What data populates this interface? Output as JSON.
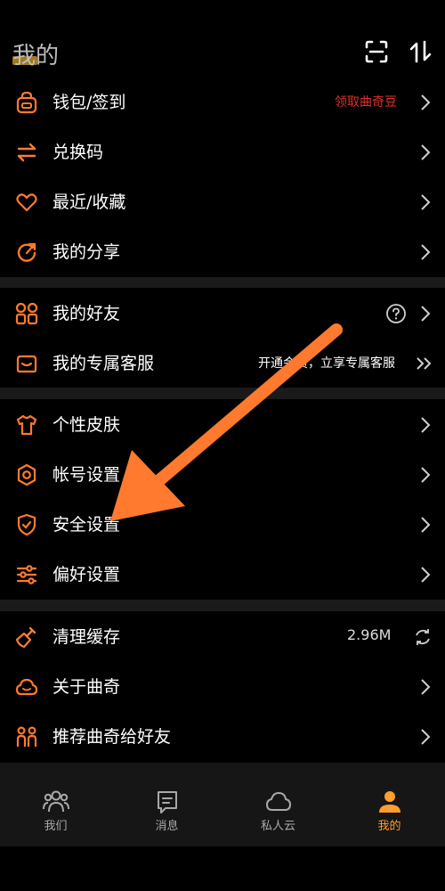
{
  "header": {
    "title": "我的"
  },
  "group1": [
    {
      "key": "wallet",
      "label": "钱包/签到",
      "extra": "领取曲奇豆",
      "icon": "wallet-icon"
    },
    {
      "key": "redeem",
      "label": "兑换码",
      "icon": "exchange-icon"
    },
    {
      "key": "recent",
      "label": "最近/收藏",
      "icon": "heart-icon"
    },
    {
      "key": "share",
      "label": "我的分享",
      "icon": "share-icon"
    }
  ],
  "group2": [
    {
      "key": "friends",
      "label": "我的好友",
      "icon": "friends-icon"
    },
    {
      "key": "service",
      "label": "我的专属客服",
      "extra": "开通会员，立享专属客服",
      "icon": "customer-service-icon"
    }
  ],
  "group3": [
    {
      "key": "skin",
      "label": "个性皮肤",
      "icon": "shirt-icon"
    },
    {
      "key": "account",
      "label": "帐号设置",
      "icon": "gear-icon"
    },
    {
      "key": "security",
      "label": "安全设置",
      "icon": "shield-icon"
    },
    {
      "key": "prefs",
      "label": "偏好设置",
      "icon": "sliders-icon"
    }
  ],
  "group4": [
    {
      "key": "cache",
      "label": "清理缓存",
      "extra": "2.96M",
      "icon": "broom-icon"
    },
    {
      "key": "about",
      "label": "关于曲奇",
      "icon": "cloud-icon"
    },
    {
      "key": "recommend",
      "label": "推荐曲奇给好友",
      "icon": "people-icon"
    }
  ],
  "tabs": [
    {
      "key": "we",
      "label": "我们"
    },
    {
      "key": "messages",
      "label": "消息"
    },
    {
      "key": "cloud",
      "label": "私人云"
    },
    {
      "key": "me",
      "label": "我的"
    }
  ],
  "colors": {
    "accent": "#ff7a2e",
    "promo": "#e0302a",
    "tab_active": "#ff9d2e",
    "separator": "#1a1a1a"
  }
}
